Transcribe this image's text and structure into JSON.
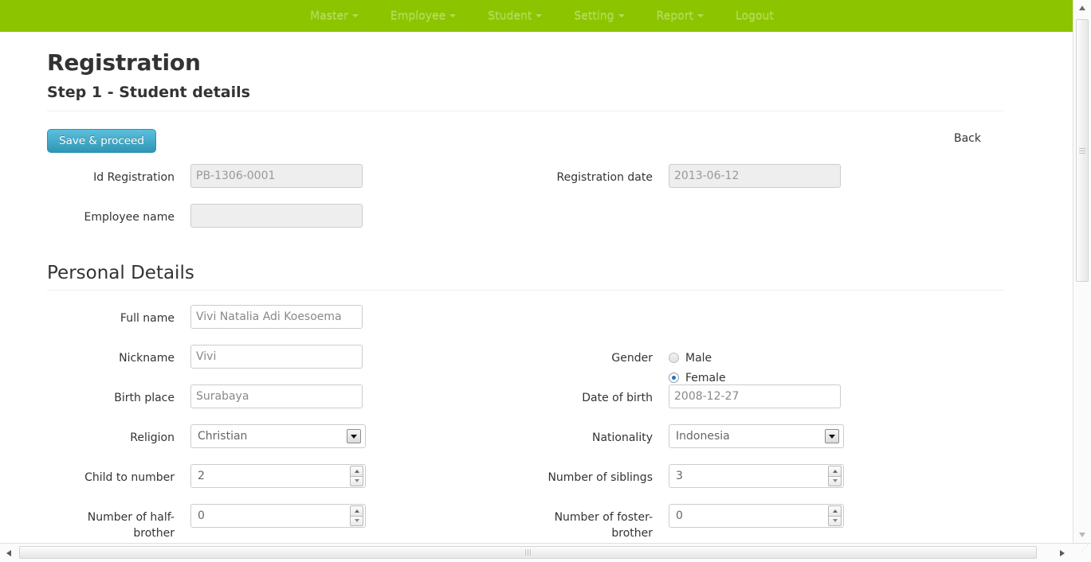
{
  "navbar": {
    "brand_color": "#8cc400",
    "link_color": "#b4dc5a",
    "items": [
      {
        "label": "Master",
        "has_caret": true,
        "name": "nav-item-master"
      },
      {
        "label": "Employee",
        "has_caret": true,
        "name": "nav-item-employee"
      },
      {
        "label": "Student",
        "has_caret": true,
        "name": "nav-item-student"
      },
      {
        "label": "Setting",
        "has_caret": true,
        "name": "nav-item-setting"
      },
      {
        "label": "Report",
        "has_caret": true,
        "name": "nav-item-report"
      },
      {
        "label": "Logout",
        "has_caret": false,
        "name": "nav-item-logout"
      }
    ]
  },
  "header": {
    "title": "Registration",
    "step_title": "Step 1 - Student details"
  },
  "actions": {
    "save_label": "Save & proceed",
    "back_label": "Back",
    "primary_color": "#2f96b4"
  },
  "registration": {
    "id_label": "Id Registration",
    "id_value": "PB-1306-0001",
    "date_label": "Registration date",
    "date_value": "2013-06-12",
    "employee_label": "Employee name",
    "employee_value": ""
  },
  "personal": {
    "section_title": "Personal Details",
    "full_name_label": "Full name",
    "full_name_value": "Vivi Natalia Adi Koesoema",
    "nickname_label": "Nickname",
    "nickname_value": "Vivi",
    "birth_place_label": "Birth place",
    "birth_place_value": "Surabaya",
    "religion_label": "Religion",
    "religion_value": "Christian",
    "child_to_number_label": "Child to number",
    "child_to_number_value": "2",
    "half_brother_label": "Number of half-brother",
    "half_brother_value": "0",
    "gender_label": "Gender",
    "gender_options": [
      {
        "label": "Male",
        "checked": false
      },
      {
        "label": "Female",
        "checked": true
      }
    ],
    "dob_label": "Date of birth",
    "dob_value": "2008-12-27",
    "nationality_label": "Nationality",
    "nationality_value": "Indonesia",
    "siblings_label": "Number of siblings",
    "siblings_value": "3",
    "foster_brother_label": "Number of foster-brother",
    "foster_brother_value": "0"
  }
}
